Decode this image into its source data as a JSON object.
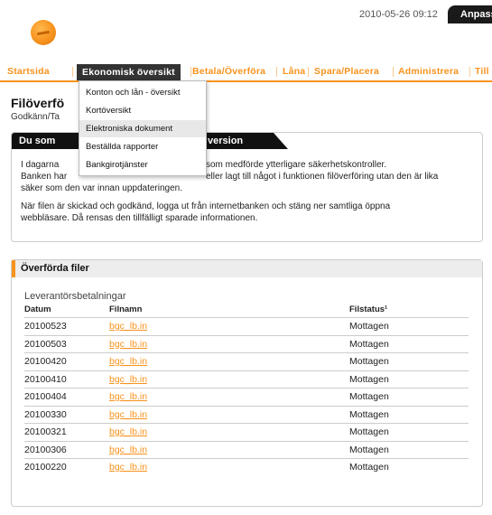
{
  "header": {
    "datetime": "2010-05-26 09:12",
    "customize_label": "Anpassa"
  },
  "nav": {
    "items": [
      "Startsida",
      "Ekonomisk översikt",
      "Betala/Överföra",
      "Låna",
      "Spara/Placera",
      "Administrera",
      "Till"
    ]
  },
  "dropdown": {
    "items": [
      "Konton och lån - översikt",
      "Kortöversikt",
      "Elektroniska dokument",
      "Beställda rapporter",
      "Bankgirotjänster"
    ],
    "highlighted": "Elektroniska dokument"
  },
  "page": {
    "title": "Filöverfö",
    "subtitle": "Godkänn/Ta"
  },
  "info": {
    "tab_left": "Du som",
    "tab_right": "version",
    "line1_left": "I dagarna",
    "line1_right": "som medförde ytterligare säkerhetskontroller.",
    "line2_left": "Banken har",
    "line2_right": "eller lagt till något i funktionen filöverföring utan den är lika",
    "line3": "säker som den var innan uppdateringen.",
    "line4": "När filen är skickad och godkänd, logga ut från internetbanken och stäng ner samtliga öppna",
    "line5": "webbläsare. Då rensas den tillfälligt sparade informationen."
  },
  "files": {
    "heading": "Överförda filer",
    "section": "Leverantörsbetalningar",
    "columns": {
      "date": "Datum",
      "filename": "Filnamn",
      "status": "Filstatus¹"
    },
    "rows": [
      {
        "date": "20100523",
        "filename": "bgc_lb.in",
        "status": "Mottagen"
      },
      {
        "date": "20100503",
        "filename": "bgc_lb.in",
        "status": "Mottagen"
      },
      {
        "date": "20100420",
        "filename": "bgc_lb.in",
        "status": "Mottagen"
      },
      {
        "date": "20100410",
        "filename": "bgc_lb.in",
        "status": "Mottagen"
      },
      {
        "date": "20100404",
        "filename": "bgc_lb.in",
        "status": "Mottagen"
      },
      {
        "date": "20100330",
        "filename": "bgc_lb.in",
        "status": "Mottagen"
      },
      {
        "date": "20100321",
        "filename": "bgc_lb.in",
        "status": "Mottagen"
      },
      {
        "date": "20100306",
        "filename": "bgc_lb.in",
        "status": "Mottagen"
      },
      {
        "date": "20100220",
        "filename": "bgc_lb.in",
        "status": "Mottagen"
      }
    ]
  },
  "colors": {
    "accent": "#f7931e",
    "dark": "#111111"
  }
}
